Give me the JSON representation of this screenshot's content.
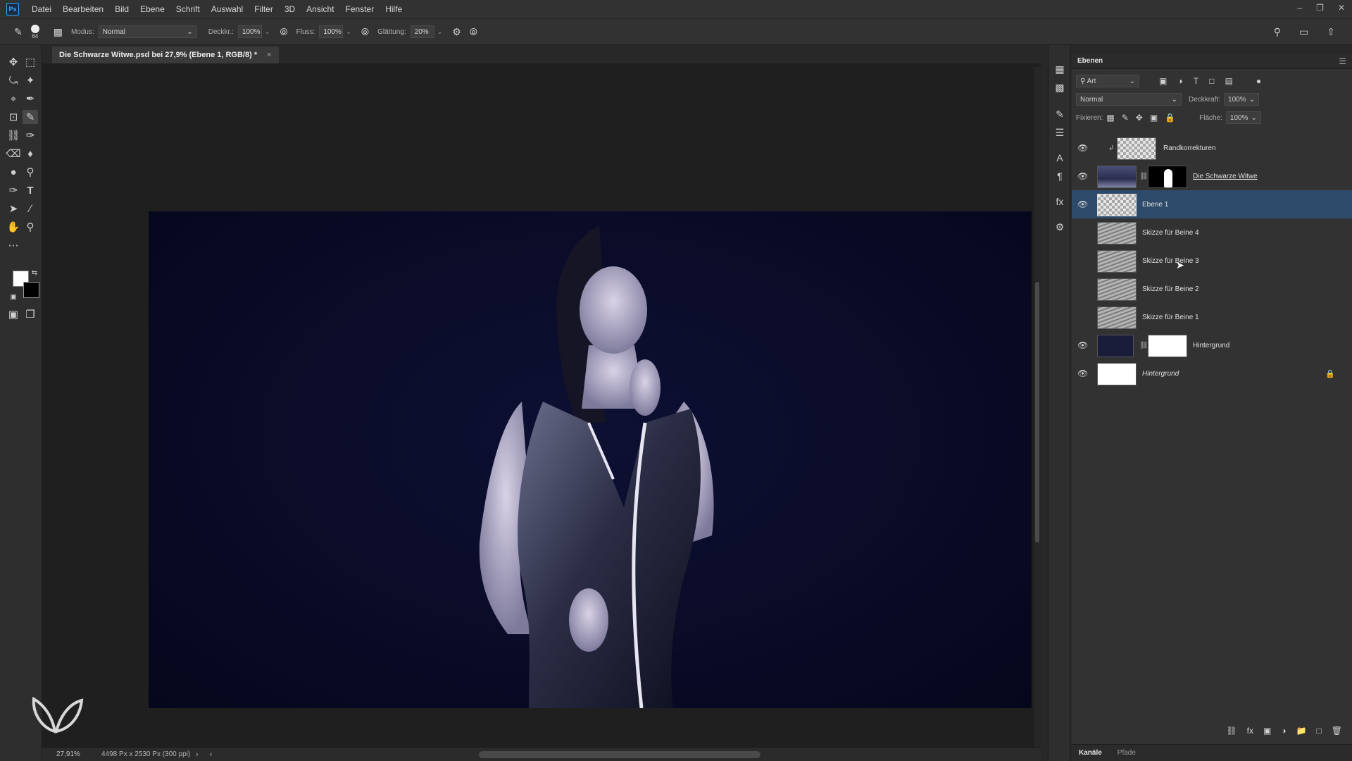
{
  "app": {
    "logo": "Ps"
  },
  "menu": [
    "Datei",
    "Bearbeiten",
    "Bild",
    "Ebene",
    "Schrift",
    "Auswahl",
    "Filter",
    "3D",
    "Ansicht",
    "Fenster",
    "Hilfe"
  ],
  "options": {
    "brush_size": "64",
    "mode_label": "Modus:",
    "mode_value": "Normal",
    "opacity_label": "Deckkr.:",
    "opacity_value": "100%",
    "flow_label": "Fluss:",
    "flow_value": "100%",
    "smoothing_label": "Glättung:",
    "smoothing_value": "20%"
  },
  "document": {
    "tab_title": "Die Schwarze Witwe.psd bei 27,9% (Ebene 1, RGB/8) *",
    "zoom": "27,91%",
    "size": "4498 Px x 2530 Px (300 ppi)"
  },
  "colors": {
    "foreground": "#ffffff",
    "background": "#000000",
    "selection": "#2d4a6a",
    "accent": "#31a8ff"
  },
  "layers_panel": {
    "tab": "Ebenen",
    "filter_value": "Art",
    "blend_mode": "Normal",
    "opacity_label": "Deckkraft:",
    "opacity_value": "100%",
    "lock_label": "Fixieren:",
    "fill_label": "Fläche:",
    "fill_value": "100%",
    "layers": [
      {
        "name": "Randkorrekturen",
        "visible": true
      },
      {
        "name": "Die Schwarze Witwe",
        "visible": true
      },
      {
        "name": "Ebene 1",
        "visible": true,
        "selected": true
      },
      {
        "name": "Skizze für Beine 4",
        "visible": false
      },
      {
        "name": "Skizze für Beine 3",
        "visible": false
      },
      {
        "name": "Skizze für Beine 2",
        "visible": false
      },
      {
        "name": "Skizze für Beine 1",
        "visible": false
      },
      {
        "name": "Hintergrund",
        "visible": true
      },
      {
        "name": "Hintergrund",
        "visible": true,
        "locked": true
      }
    ],
    "bottom_tabs": [
      "Kanäle",
      "Pfade"
    ]
  },
  "icons": {
    "tools": [
      "move-icon",
      "marquee-icon",
      "lasso-icon",
      "magic-wand-icon",
      "crop-icon",
      "eyedropper-icon",
      "frame-icon",
      "brush-icon",
      "stamp-icon",
      "history-brush-icon",
      "eraser-icon",
      "bucket-icon",
      "blur-icon",
      "dodge-icon",
      "pen-icon",
      "type-icon",
      "path-select-icon",
      "line-icon",
      "hand-icon",
      "zoom-icon",
      "more-icon"
    ]
  }
}
